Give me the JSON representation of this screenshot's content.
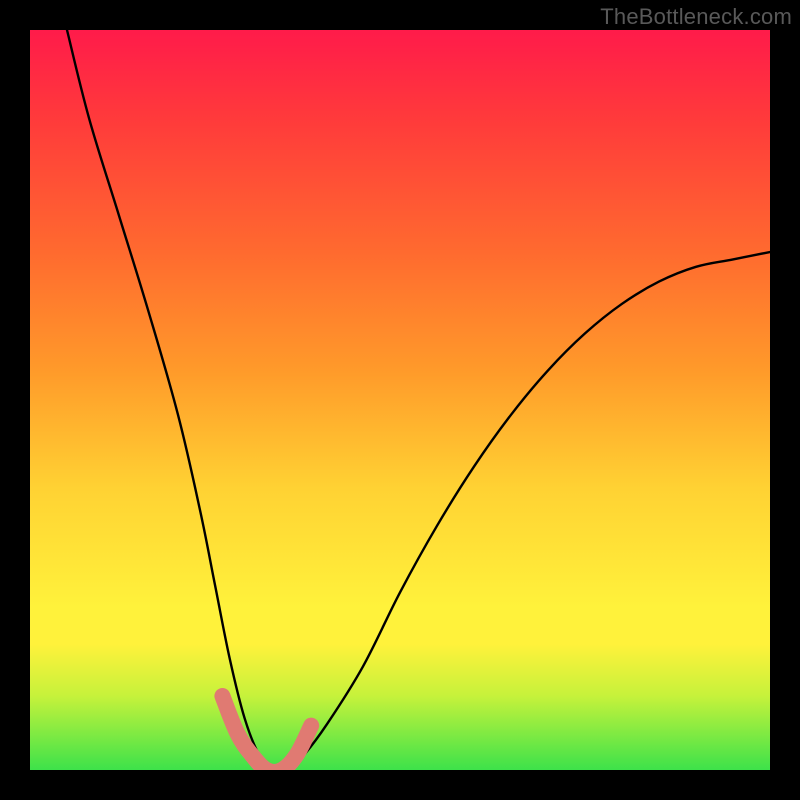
{
  "watermark": "TheBottleneck.com",
  "chart_data": {
    "type": "line",
    "title": "",
    "xlabel": "",
    "ylabel": "",
    "xlim": [
      0,
      100
    ],
    "ylim": [
      0,
      100
    ],
    "series": [
      {
        "name": "bottleneck-curve",
        "color": "#000000",
        "x": [
          5,
          8,
          12,
          16,
          20,
          23,
          25,
          27,
          29,
          31,
          33,
          35,
          37,
          40,
          45,
          50,
          55,
          60,
          65,
          70,
          75,
          80,
          85,
          90,
          95,
          100
        ],
        "y": [
          100,
          88,
          75,
          62,
          48,
          35,
          25,
          15,
          7,
          2,
          0,
          0,
          2,
          6,
          14,
          24,
          33,
          41,
          48,
          54,
          59,
          63,
          66,
          68,
          69,
          70
        ]
      },
      {
        "name": "bottleneck-highlight",
        "color": "#e07a72",
        "x": [
          26,
          28,
          30,
          32,
          34,
          36,
          38
        ],
        "y": [
          10,
          5,
          2,
          0,
          0,
          2,
          6
        ]
      }
    ],
    "background": {
      "type": "vertical-gradient",
      "stops": [
        {
          "pos": 0.0,
          "color": "#ff1b4a"
        },
        {
          "pos": 0.12,
          "color": "#ff3a3b"
        },
        {
          "pos": 0.3,
          "color": "#ff6a2f"
        },
        {
          "pos": 0.46,
          "color": "#ff9a2a"
        },
        {
          "pos": 0.62,
          "color": "#ffd233"
        },
        {
          "pos": 0.78,
          "color": "#fff23b"
        },
        {
          "pos": 0.83,
          "color": "#fff23b"
        },
        {
          "pos": 0.9,
          "color": "#c6f23b"
        },
        {
          "pos": 1.0,
          "color": "#3de24a"
        }
      ]
    }
  }
}
